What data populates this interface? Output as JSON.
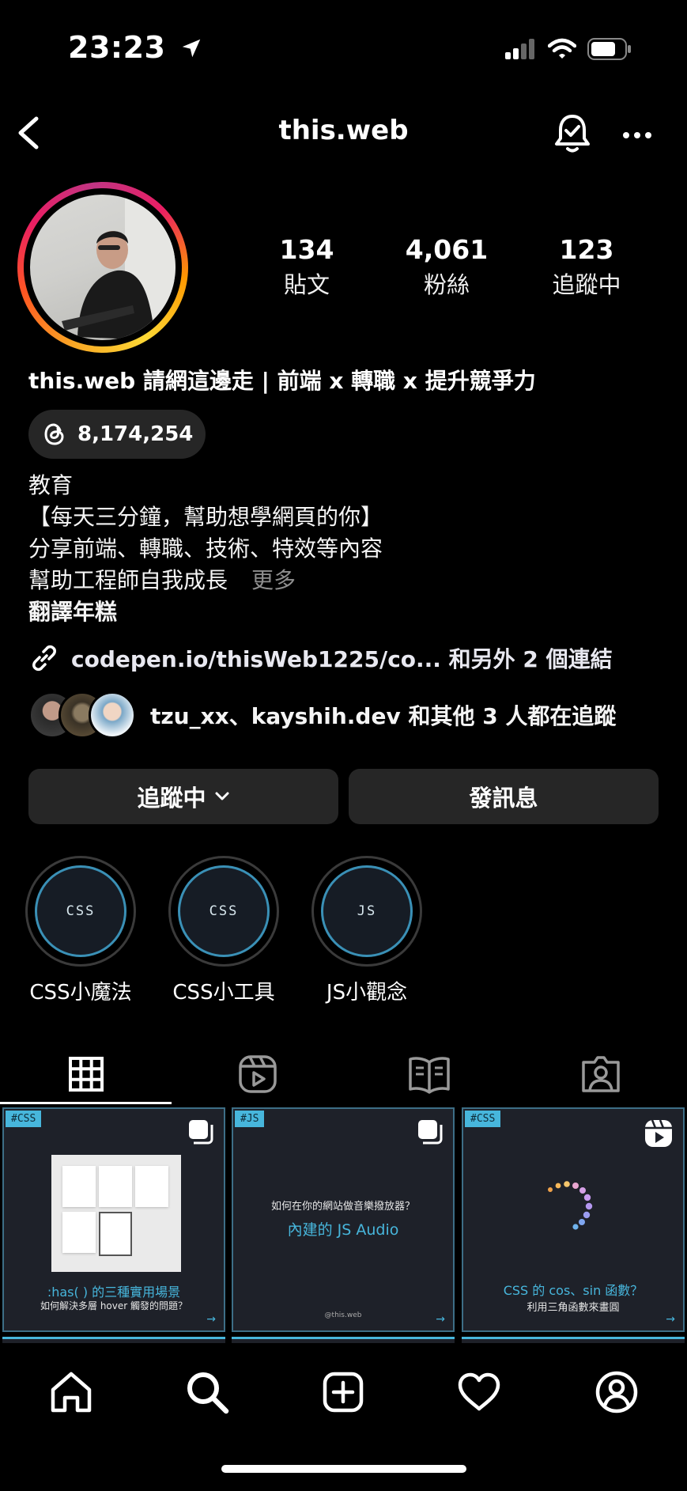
{
  "status_bar": {
    "time": "23:23"
  },
  "header": {
    "title": "this.web"
  },
  "profile": {
    "stats": [
      {
        "value": "134",
        "label": "貼文"
      },
      {
        "value": "4,061",
        "label": "粉絲"
      },
      {
        "value": "123",
        "label": "追蹤中"
      }
    ],
    "name": "this.web 請網這邊走 | 前端 x 轉職 x 提升競爭力",
    "threads_count": "8,174,254",
    "category": "教育",
    "bio_lines": [
      "【每天三分鐘，幫助想學網頁的你】",
      "分享前端、轉職、技術、特效等內容",
      "幫助工程師自我成長"
    ],
    "more": "更多",
    "translate": "翻譯年糕",
    "link": "codepen.io/thisWeb1225/co... 和另外 2 個連結",
    "followed_by": "tzu_xx、kayshih.dev 和其他 3 人都在追蹤"
  },
  "buttons": {
    "following": "追蹤中",
    "message": "發訊息"
  },
  "highlights": [
    {
      "cover": "CSS",
      "label": "CSS小魔法"
    },
    {
      "cover": "CSS",
      "label": "CSS小工具"
    },
    {
      "cover": "JS",
      "label": "JS小觀念"
    }
  ],
  "posts": [
    {
      "tag": "#CSS",
      "title": ":has( ) 的三種實用場景",
      "subtitle": "如何解決多層 hover 觸發的問題？",
      "title_color": "#47b6dc"
    },
    {
      "tag": "#JS",
      "question": "如何在你的網站做音樂撥放器？",
      "title": "內建的 JS Audio",
      "credit": "@this.web",
      "title_color": "#47b6dc"
    },
    {
      "tag": "#CSS",
      "title": "CSS 的 cos、sin 函數？",
      "subtitle": "利用三角函數來畫圓",
      "title_color": "#47b6dc"
    }
  ],
  "colors": {
    "accent": "#47b6dc",
    "button_bg": "#262626",
    "background": "#000000"
  }
}
